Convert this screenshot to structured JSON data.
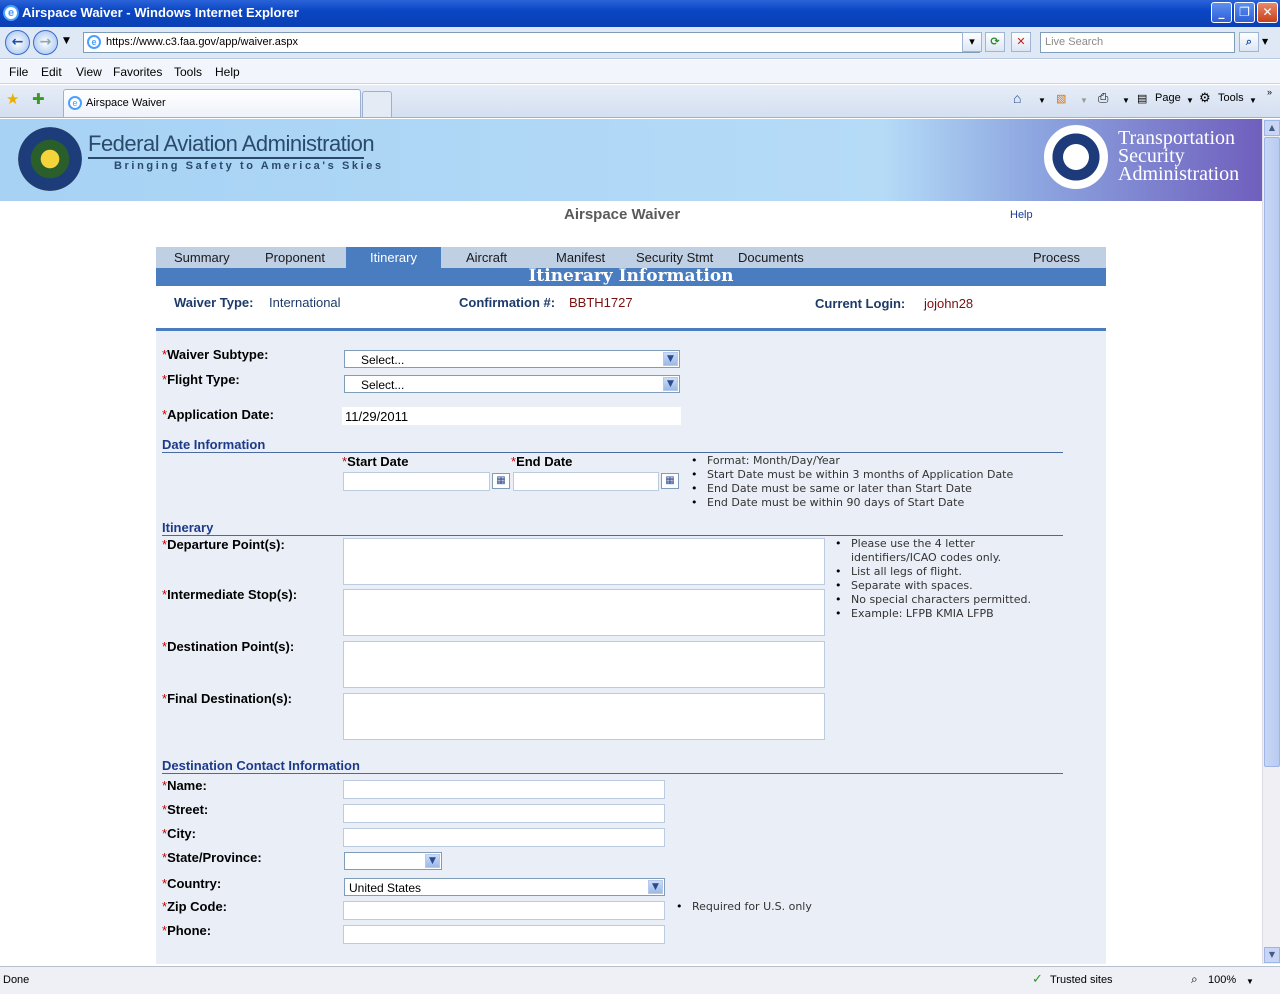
{
  "window": {
    "title": "Airspace Waiver - Windows Internet Explorer"
  },
  "browser": {
    "url": "https://www.c3.faa.gov/app/waiver.aspx",
    "search_placeholder": "Live Search",
    "menu": [
      "File",
      "Edit",
      "View",
      "Favorites",
      "Tools",
      "Help"
    ],
    "tab_title": "Airspace Waiver",
    "cmd_page": "Page",
    "cmd_tools": "Tools"
  },
  "banner": {
    "faa_title": "Federal Aviation Administration",
    "faa_tagline": "Bringing Safety to America's Skies",
    "tsa_line1": "Transportation",
    "tsa_line2": "Security",
    "tsa_line3": "Administration"
  },
  "page": {
    "title": "Airspace Waiver",
    "help": "Help"
  },
  "nav_tabs": [
    "Summary",
    "Proponent",
    "Itinerary",
    "Aircraft",
    "Manifest",
    "Security Stmt",
    "Documents",
    "Process"
  ],
  "active_tab": "Itinerary",
  "section_title": "Itinerary Information",
  "header": {
    "waiver_type_label": "Waiver Type:",
    "waiver_type_value": "International",
    "confirmation_label": "Confirmation #:",
    "confirmation_value": "BBTH1727",
    "login_label": "Current Login:",
    "login_value": "jojohn28"
  },
  "form": {
    "waiver_subtype_label": "Waiver Subtype:",
    "waiver_subtype_value": "Select...",
    "flight_type_label": "Flight Type:",
    "flight_type_value": "Select...",
    "app_date_label": "Application Date:",
    "app_date_value": "11/29/2011",
    "date_section": "Date Information",
    "start_date_label": "Start Date",
    "end_date_label": "End Date",
    "date_notes": [
      "Format: Month/Day/Year",
      "Start Date must be within 3 months of Application Date",
      "End Date must be same or later than Start Date",
      "End Date must be within 90 days of Start Date"
    ],
    "itinerary_section": "Itinerary",
    "departure_label": "Departure Point(s):",
    "intermediate_label": "Intermediate Stop(s):",
    "destination_label": "Destination Point(s):",
    "final_label": "Final Destination(s):",
    "itin_notes": [
      "Please use the 4 letter",
      "identifiers/ICAO codes only.",
      "List all legs of flight.",
      "Separate with spaces.",
      "No special characters permitted.",
      "Example:  LFPB KMIA LFPB"
    ],
    "contact_section": "Destination Contact Information",
    "name_label": "Name:",
    "street_label": "Street:",
    "city_label": "City:",
    "state_label": "State/Province:",
    "country_label": "Country:",
    "country_value": "United States",
    "zip_label": "Zip Code:",
    "zip_note": "Required for U.S. only",
    "phone_label": "Phone:"
  },
  "status": {
    "left": "Done",
    "zone": "Trusted sites",
    "zoom": "100%"
  }
}
